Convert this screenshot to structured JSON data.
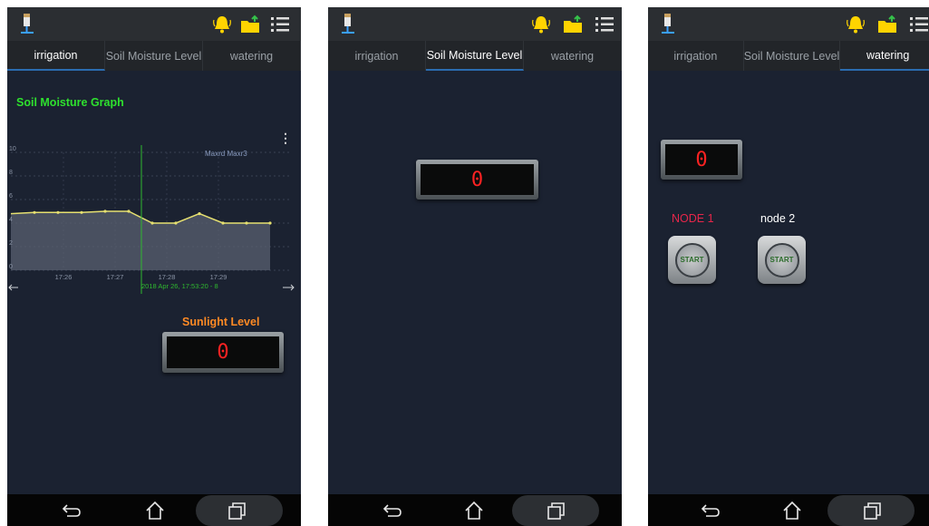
{
  "tabs": [
    "irrigation",
    "Soil Moisture Level",
    "watering"
  ],
  "screen1": {
    "active_tab": 0,
    "graph_title": "Soil Moisture Graph",
    "legend": "Maxrd Maxr3",
    "menu_glyph": "⋮",
    "cursor_label": "2018 Apr 26, 17:53:20 - 8",
    "sunlight_label": "Sunlight Level",
    "sunlight_value": "0",
    "chart_data": {
      "type": "area",
      "title": "Soil Moisture Graph",
      "x": [
        "17:26",
        "17:27",
        "17:28",
        "17:29"
      ],
      "y_ticks": [
        10,
        8,
        6,
        4,
        2,
        0
      ],
      "ylim": [
        0,
        10
      ],
      "series": [
        {
          "values": [
            4.8,
            4.9,
            4.9,
            4.9,
            5.0,
            5.0,
            4.0,
            4.0,
            4.8,
            4.0,
            4.0,
            4.0
          ]
        }
      ],
      "grid": true
    }
  },
  "screen2": {
    "active_tab": 1,
    "moisture_value": "0"
  },
  "screen3": {
    "active_tab": 2,
    "value": "0",
    "node1_label": "NODE 1",
    "node2_label": "node 2",
    "start_label": "START"
  },
  "colors": {
    "background": "#1b2231",
    "graph_title": "#2ee02e",
    "sunlight_label": "#ff8a24",
    "node1_label": "#e8264a",
    "lcd_digit": "#ff2222"
  },
  "icons": [
    "app-icon",
    "bell-icon",
    "folder-icon",
    "menu-icon",
    "back-icon",
    "home-icon",
    "recent-apps-icon"
  ]
}
